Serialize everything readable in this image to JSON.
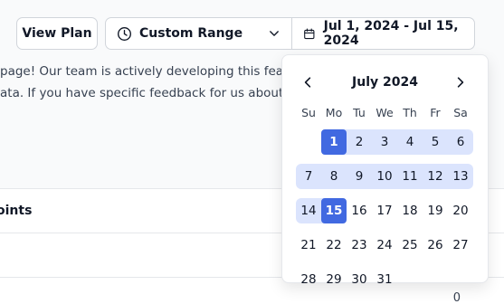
{
  "toolbar": {
    "view_plan": "View Plan",
    "range_select": "Custom Range",
    "date_range": "Jul 1, 2024 - Jul 15, 2024"
  },
  "notice": {
    "line1": "page! Our team is actively developing this featu",
    "line2": "ata. If you have specific feedback for us about"
  },
  "panel": {
    "header": "oints",
    "value": "0"
  },
  "calendar": {
    "month_label": "July 2024",
    "weekdays": [
      "Su",
      "Mo",
      "Tu",
      "We",
      "Th",
      "Fr",
      "Sa"
    ],
    "weeks": [
      [
        "",
        "1",
        "2",
        "3",
        "4",
        "5",
        "6"
      ],
      [
        "7",
        "8",
        "9",
        "10",
        "11",
        "12",
        "13"
      ],
      [
        "14",
        "15",
        "16",
        "17",
        "18",
        "19",
        "20"
      ],
      [
        "21",
        "22",
        "23",
        "24",
        "25",
        "26",
        "27"
      ],
      [
        "28",
        "29",
        "30",
        "31",
        "",
        "",
        ""
      ]
    ],
    "range_start": "1",
    "range_end": "15"
  },
  "colors": {
    "accent": "#4169e1",
    "range_fill": "#dbe4fd"
  },
  "icons": {
    "range_select": "clock-icon",
    "dropdown": "chevron-down-icon",
    "date_range": "calendar-icon",
    "prev": "chevron-left-icon",
    "next": "chevron-right-icon"
  }
}
